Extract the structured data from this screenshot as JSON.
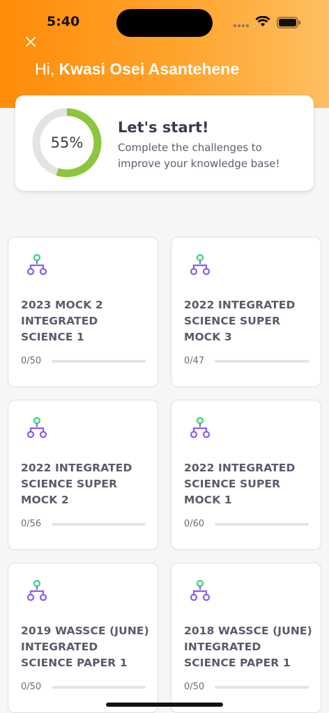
{
  "status_bar": {
    "time": "5:40"
  },
  "header": {
    "greeting_prefix": "Hi, ",
    "user_name": "Kwasi Osei Asantehene"
  },
  "progress_card": {
    "percent": 55,
    "percent_label": "55%",
    "title": "Let's start!",
    "subtitle": "Complete the challenges to improve your knowledge base!"
  },
  "colors": {
    "accent_orange": "#ff8c0a",
    "progress_green": "#8cc63f",
    "icon_green": "#2fd87a",
    "icon_purple": "#8a5cf0"
  },
  "quizzes": [
    {
      "icon": "hierarchy-icon",
      "title": "2023 MOCK 2 INTEGRATED SCIENCE 1",
      "count": "0/50",
      "progress": 0
    },
    {
      "icon": "hierarchy-icon",
      "title": "2022 INTEGRATED SCIENCE SUPER MOCK 3",
      "count": "0/47",
      "progress": 0
    },
    {
      "icon": "hierarchy-icon",
      "title": "2022 INTEGRATED SCIENCE SUPER MOCK 2",
      "count": "0/56",
      "progress": 0
    },
    {
      "icon": "hierarchy-icon",
      "title": "2022 INTEGRATED SCIENCE SUPER MOCK 1",
      "count": "0/60",
      "progress": 0
    },
    {
      "icon": "hierarchy-icon",
      "title": "2019 WASSCE (JUNE) INTEGRATED SCIENCE PAPER 1",
      "count": "0/50",
      "progress": 0
    },
    {
      "icon": "hierarchy-icon",
      "title": "2018 WASSCE (JUNE) INTEGRATED SCIENCE PAPER 1",
      "count": "0/50",
      "progress": 0
    }
  ]
}
